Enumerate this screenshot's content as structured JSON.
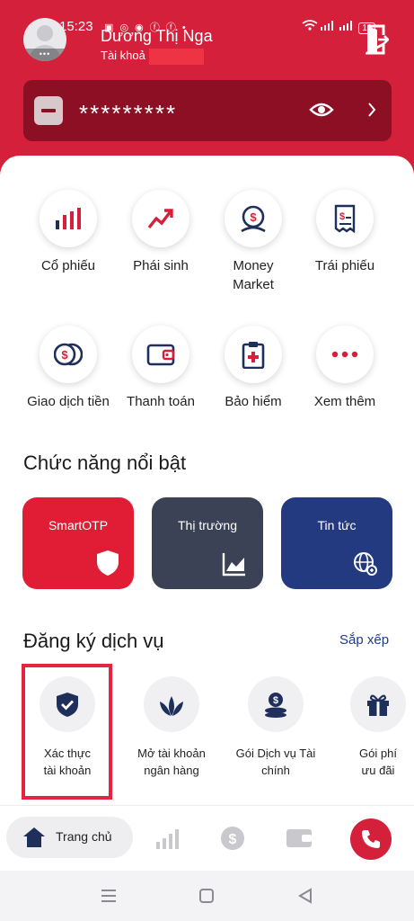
{
  "status_bar": {
    "time": "15:23",
    "battery": "10"
  },
  "user": {
    "name": "Dương Thị Nga",
    "account_label": "Tài khoả"
  },
  "balance": {
    "masked_value": "*********"
  },
  "quick_actions": [
    {
      "label": "Cổ phiếu",
      "icon": "bar-chart-icon"
    },
    {
      "label": "Phái sinh",
      "icon": "trend-arrow-icon"
    },
    {
      "label": "Money\nMarket",
      "icon": "money-market-icon"
    },
    {
      "label": "Trái phiếu",
      "icon": "bond-certificate-icon"
    },
    {
      "label": "Giao dịch tiền",
      "icon": "coins-icon"
    },
    {
      "label": "Thanh toán",
      "icon": "wallet-icon"
    },
    {
      "label": "Bảo hiểm",
      "icon": "insurance-clipboard-icon"
    },
    {
      "label": "Xem thêm",
      "icon": "more-dots-icon"
    }
  ],
  "featured": {
    "title": "Chức năng nổi bật",
    "cards": [
      {
        "label": "SmartOTP",
        "color": "#e11d35"
      },
      {
        "label": "Thị trường",
        "color": "#3c4256"
      },
      {
        "label": "Tin tức",
        "color": "#233a80"
      }
    ]
  },
  "services": {
    "title": "Đăng ký dịch vụ",
    "sort_label": "Sắp xếp",
    "items": [
      {
        "label": "Xác thực\ntài khoản",
        "icon": "shield-check-icon"
      },
      {
        "label": "Mở tài khoản\nngân hàng",
        "icon": "lotus-icon"
      },
      {
        "label": "Gói Dịch vụ Tài\nchính",
        "icon": "coin-stack-icon"
      },
      {
        "label": "Gói phí\nưu đãi",
        "icon": "gift-icon"
      }
    ]
  },
  "bottom_nav": {
    "home_label": "Trang chủ"
  },
  "colors": {
    "brand": "#d4203a",
    "balance_bg": "#8c0f24",
    "icon_navy": "#1f2f5c",
    "highlight": "#e52540",
    "link": "#1d3c8f"
  }
}
